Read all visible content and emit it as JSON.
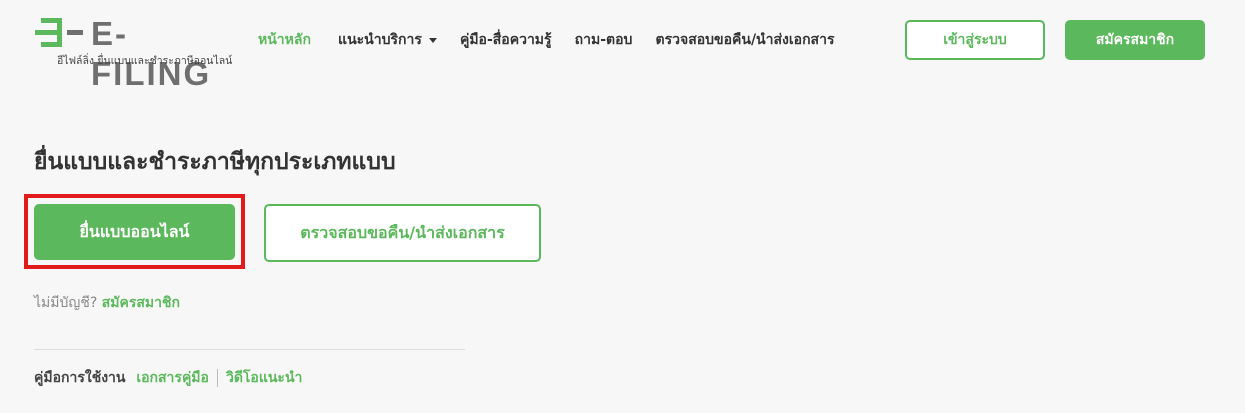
{
  "logo": {
    "title": "E-FILING",
    "tagline": "อีไฟล์ลิ่ง ยื่นแบบและชำระภาษีออนไลน์"
  },
  "nav": {
    "items": [
      {
        "label": "หน้าหลัก",
        "active": true
      },
      {
        "label": "แนะนำบริการ",
        "has_dropdown": true
      },
      {
        "label": "คู่มือ-สื่อความรู้"
      },
      {
        "label": "ถาม-ตอบ"
      },
      {
        "label": "ตรวจสอบขอคืน/นำส่งเอกสาร"
      }
    ],
    "login_label": "เข้าสู่ระบบ",
    "register_label": "สมัครสมาชิก"
  },
  "main": {
    "heading": "ยื่นแบบและชำระภาษีทุกประเภทแบบ",
    "file_online_label": "ยื่นแบบออนไลน์",
    "check_refund_label": "ตรวจสอบขอคืน/นำส่งเอกสาร",
    "no_account_text": "ไม่มีบัญชี?",
    "signup_link": "สมัครสมาชิก",
    "manual_label": "คู่มือการใช้งาน",
    "doc_manual_link": "เอกสารคู่มือ",
    "video_link": "วิดีโอแนะนำ"
  },
  "colors": {
    "accent": "#5cb85c",
    "highlight": "#e11b1b",
    "background": "#f7f7f7"
  }
}
